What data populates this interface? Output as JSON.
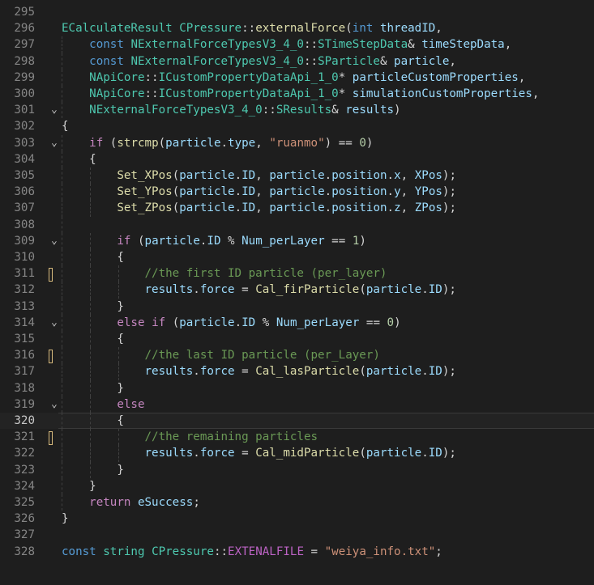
{
  "editor": {
    "lines": [
      {
        "n": "295",
        "tokens": []
      },
      {
        "n": "296",
        "tokens": [
          [
            "type",
            "ECalculateResult"
          ],
          [
            "op",
            " "
          ],
          [
            "type",
            "CPressure"
          ],
          [
            "op",
            "::"
          ],
          [
            "fn",
            "externalForce"
          ],
          [
            "op",
            "("
          ],
          [
            "kw",
            "int"
          ],
          [
            "op",
            " "
          ],
          [
            "var",
            "threadID"
          ],
          [
            "op",
            ","
          ]
        ]
      },
      {
        "n": "297",
        "tokens": [
          [
            "op",
            "    "
          ],
          [
            "kw",
            "const"
          ],
          [
            "op",
            " "
          ],
          [
            "ns",
            "NExternalForceTypesV3_4_0"
          ],
          [
            "op",
            "::"
          ],
          [
            "type",
            "STimeStepData"
          ],
          [
            "op",
            "& "
          ],
          [
            "var",
            "timeStepData"
          ],
          [
            "op",
            ","
          ]
        ]
      },
      {
        "n": "298",
        "tokens": [
          [
            "op",
            "    "
          ],
          [
            "kw",
            "const"
          ],
          [
            "op",
            " "
          ],
          [
            "ns",
            "NExternalForceTypesV3_4_0"
          ],
          [
            "op",
            "::"
          ],
          [
            "type",
            "SParticle"
          ],
          [
            "op",
            "& "
          ],
          [
            "var",
            "particle"
          ],
          [
            "op",
            ","
          ]
        ]
      },
      {
        "n": "299",
        "tokens": [
          [
            "op",
            "    "
          ],
          [
            "ns",
            "NApiCore"
          ],
          [
            "op",
            "::"
          ],
          [
            "type",
            "ICustomPropertyDataApi_1_0"
          ],
          [
            "op",
            "* "
          ],
          [
            "var",
            "particleCustomProperties"
          ],
          [
            "op",
            ","
          ]
        ]
      },
      {
        "n": "300",
        "tokens": [
          [
            "op",
            "    "
          ],
          [
            "ns",
            "NApiCore"
          ],
          [
            "op",
            "::"
          ],
          [
            "type",
            "ICustomPropertyDataApi_1_0"
          ],
          [
            "op",
            "* "
          ],
          [
            "var",
            "simulationCustomProperties"
          ],
          [
            "op",
            ","
          ]
        ]
      },
      {
        "n": "301",
        "tokens": [
          [
            "op",
            "    "
          ],
          [
            "ns",
            "NExternalForceTypesV3_4_0"
          ],
          [
            "op",
            "::"
          ],
          [
            "type",
            "SResults"
          ],
          [
            "op",
            "& "
          ],
          [
            "var",
            "results"
          ],
          [
            "op",
            ")"
          ]
        ]
      },
      {
        "n": "302",
        "tokens": [
          [
            "op",
            "{"
          ]
        ]
      },
      {
        "n": "303",
        "tokens": [
          [
            "op",
            "    "
          ],
          [
            "ctrl",
            "if"
          ],
          [
            "op",
            " ("
          ],
          [
            "fn",
            "strcmp"
          ],
          [
            "op",
            "("
          ],
          [
            "var",
            "particle"
          ],
          [
            "op",
            "."
          ],
          [
            "var",
            "type"
          ],
          [
            "op",
            ", "
          ],
          [
            "str",
            "\"ruanmo\""
          ],
          [
            "op",
            ") == "
          ],
          [
            "num",
            "0"
          ],
          [
            "op",
            ")"
          ]
        ]
      },
      {
        "n": "304",
        "tokens": [
          [
            "op",
            "    {"
          ]
        ]
      },
      {
        "n": "305",
        "tokens": [
          [
            "op",
            "        "
          ],
          [
            "fn",
            "Set_XPos"
          ],
          [
            "op",
            "("
          ],
          [
            "var",
            "particle"
          ],
          [
            "op",
            "."
          ],
          [
            "var",
            "ID"
          ],
          [
            "op",
            ", "
          ],
          [
            "var",
            "particle"
          ],
          [
            "op",
            "."
          ],
          [
            "var",
            "position"
          ],
          [
            "op",
            "."
          ],
          [
            "var",
            "x"
          ],
          [
            "op",
            ", "
          ],
          [
            "var",
            "XPos"
          ],
          [
            "op",
            ");"
          ]
        ]
      },
      {
        "n": "306",
        "tokens": [
          [
            "op",
            "        "
          ],
          [
            "fn",
            "Set_YPos"
          ],
          [
            "op",
            "("
          ],
          [
            "var",
            "particle"
          ],
          [
            "op",
            "."
          ],
          [
            "var",
            "ID"
          ],
          [
            "op",
            ", "
          ],
          [
            "var",
            "particle"
          ],
          [
            "op",
            "."
          ],
          [
            "var",
            "position"
          ],
          [
            "op",
            "."
          ],
          [
            "var",
            "y"
          ],
          [
            "op",
            ", "
          ],
          [
            "var",
            "YPos"
          ],
          [
            "op",
            ");"
          ]
        ]
      },
      {
        "n": "307",
        "tokens": [
          [
            "op",
            "        "
          ],
          [
            "fn",
            "Set_ZPos"
          ],
          [
            "op",
            "("
          ],
          [
            "var",
            "particle"
          ],
          [
            "op",
            "."
          ],
          [
            "var",
            "ID"
          ],
          [
            "op",
            ", "
          ],
          [
            "var",
            "particle"
          ],
          [
            "op",
            "."
          ],
          [
            "var",
            "position"
          ],
          [
            "op",
            "."
          ],
          [
            "var",
            "z"
          ],
          [
            "op",
            ", "
          ],
          [
            "var",
            "ZPos"
          ],
          [
            "op",
            ");"
          ]
        ]
      },
      {
        "n": "308",
        "tokens": []
      },
      {
        "n": "309",
        "tokens": [
          [
            "op",
            "        "
          ],
          [
            "ctrl",
            "if"
          ],
          [
            "op",
            " ("
          ],
          [
            "var",
            "particle"
          ],
          [
            "op",
            "."
          ],
          [
            "var",
            "ID"
          ],
          [
            "op",
            " % "
          ],
          [
            "var",
            "Num_perLayer"
          ],
          [
            "op",
            " == "
          ],
          [
            "num",
            "1"
          ],
          [
            "op",
            ")"
          ]
        ]
      },
      {
        "n": "310",
        "tokens": [
          [
            "op",
            "        {"
          ]
        ]
      },
      {
        "n": "311",
        "tokens": [
          [
            "op",
            "            "
          ],
          [
            "cmt",
            "//the first ID particle (per_layer)"
          ]
        ]
      },
      {
        "n": "312",
        "tokens": [
          [
            "op",
            "            "
          ],
          [
            "var",
            "results"
          ],
          [
            "op",
            "."
          ],
          [
            "var",
            "force"
          ],
          [
            "op",
            " = "
          ],
          [
            "fn",
            "Cal_firParticle"
          ],
          [
            "op",
            "("
          ],
          [
            "var",
            "particle"
          ],
          [
            "op",
            "."
          ],
          [
            "var",
            "ID"
          ],
          [
            "op",
            ");"
          ]
        ]
      },
      {
        "n": "313",
        "tokens": [
          [
            "op",
            "        }"
          ]
        ]
      },
      {
        "n": "314",
        "tokens": [
          [
            "op",
            "        "
          ],
          [
            "ctrl",
            "else"
          ],
          [
            "op",
            " "
          ],
          [
            "ctrl",
            "if"
          ],
          [
            "op",
            " ("
          ],
          [
            "var",
            "particle"
          ],
          [
            "op",
            "."
          ],
          [
            "var",
            "ID"
          ],
          [
            "op",
            " % "
          ],
          [
            "var",
            "Num_perLayer"
          ],
          [
            "op",
            " == "
          ],
          [
            "num",
            "0"
          ],
          [
            "op",
            ")"
          ]
        ]
      },
      {
        "n": "315",
        "tokens": [
          [
            "op",
            "        {"
          ]
        ]
      },
      {
        "n": "316",
        "tokens": [
          [
            "op",
            "            "
          ],
          [
            "cmt",
            "//the last ID particle (per_Layer)"
          ]
        ]
      },
      {
        "n": "317",
        "tokens": [
          [
            "op",
            "            "
          ],
          [
            "var",
            "results"
          ],
          [
            "op",
            "."
          ],
          [
            "var",
            "force"
          ],
          [
            "op",
            " = "
          ],
          [
            "fn",
            "Cal_lasParticle"
          ],
          [
            "op",
            "("
          ],
          [
            "var",
            "particle"
          ],
          [
            "op",
            "."
          ],
          [
            "var",
            "ID"
          ],
          [
            "op",
            ");"
          ]
        ]
      },
      {
        "n": "318",
        "tokens": [
          [
            "op",
            "        }"
          ]
        ]
      },
      {
        "n": "319",
        "tokens": [
          [
            "op",
            "        "
          ],
          [
            "ctrl",
            "else"
          ]
        ]
      },
      {
        "n": "320",
        "tokens": [
          [
            "op",
            "        {"
          ]
        ]
      },
      {
        "n": "321",
        "tokens": [
          [
            "op",
            "            "
          ],
          [
            "cmt",
            "//the remaining particles"
          ]
        ]
      },
      {
        "n": "322",
        "tokens": [
          [
            "op",
            "            "
          ],
          [
            "var",
            "results"
          ],
          [
            "op",
            "."
          ],
          [
            "var",
            "force"
          ],
          [
            "op",
            " = "
          ],
          [
            "fn",
            "Cal_midParticle"
          ],
          [
            "op",
            "("
          ],
          [
            "var",
            "particle"
          ],
          [
            "op",
            "."
          ],
          [
            "var",
            "ID"
          ],
          [
            "op",
            ");"
          ]
        ]
      },
      {
        "n": "323",
        "tokens": [
          [
            "op",
            "        }"
          ]
        ]
      },
      {
        "n": "324",
        "tokens": [
          [
            "op",
            "    }"
          ]
        ]
      },
      {
        "n": "325",
        "tokens": [
          [
            "op",
            "    "
          ],
          [
            "ctrl",
            "return"
          ],
          [
            "op",
            " "
          ],
          [
            "enum",
            "eSuccess"
          ],
          [
            "op",
            ";"
          ]
        ]
      },
      {
        "n": "326",
        "tokens": [
          [
            "op",
            "}"
          ]
        ]
      },
      {
        "n": "327",
        "tokens": []
      },
      {
        "n": "328",
        "tokens": [
          [
            "kw",
            "const"
          ],
          [
            "op",
            " "
          ],
          [
            "type",
            "string"
          ],
          [
            "op",
            " "
          ],
          [
            "type",
            "CPressure"
          ],
          [
            "op",
            "::"
          ],
          [
            "mac",
            "EXTENALFILE"
          ],
          [
            "op",
            " = "
          ],
          [
            "str",
            "\"weiya_info.txt\""
          ],
          [
            "op",
            ";"
          ]
        ]
      }
    ],
    "fold_lines": [
      "301",
      "303",
      "309",
      "314",
      "319"
    ],
    "modified_lines": [
      "311",
      "316",
      "321"
    ],
    "current_line": "320",
    "fold_icon": "chevron-down-icon",
    "colors": {
      "background": "#1e1e1e",
      "line_number": "#858585",
      "current_line_number": "#c6c6c6",
      "keyword": "#569cd6",
      "control": "#c586c0",
      "type": "#4ec9b0",
      "function": "#dcdcaa",
      "variable": "#9cdcfe",
      "string": "#ce9178",
      "number": "#b5cea8",
      "comment": "#6a9955",
      "modified_marker": "#d7ba7d"
    }
  }
}
